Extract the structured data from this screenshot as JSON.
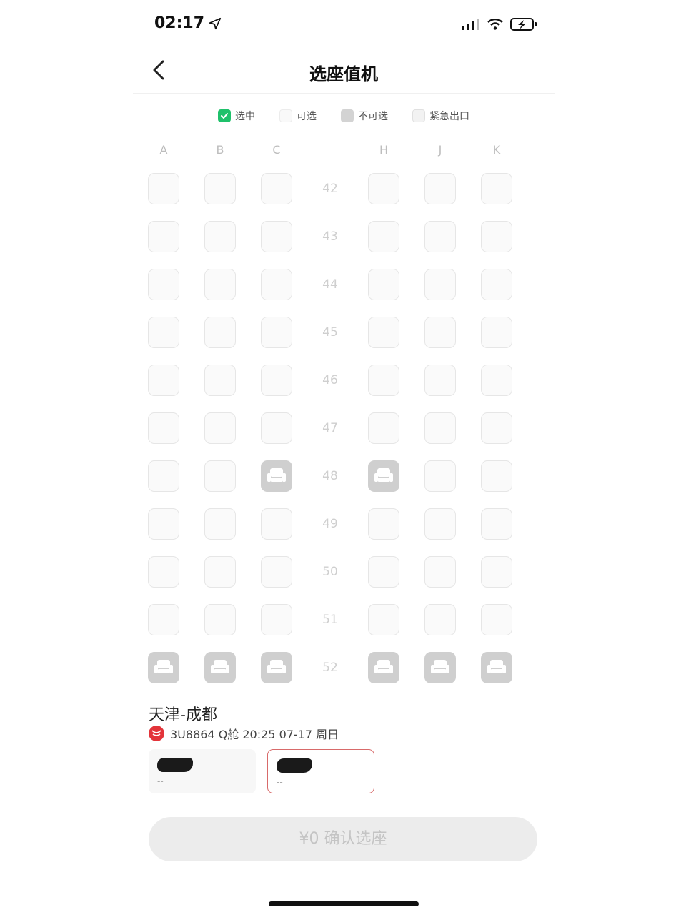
{
  "status": {
    "time": "02:17"
  },
  "header": {
    "title": "选座值机"
  },
  "legend": [
    {
      "label": "选中",
      "icon": "check-icon"
    },
    {
      "label": "可选",
      "icon": "available-seat-icon"
    },
    {
      "label": "不可选",
      "icon": "unavailable-seat-icon"
    },
    {
      "label": "紧急出口",
      "icon": "emergency-exit-icon"
    }
  ],
  "columns": [
    "A",
    "B",
    "C",
    "H",
    "J",
    "K"
  ],
  "rows": [
    {
      "number": "42",
      "unavailable": []
    },
    {
      "number": "43",
      "unavailable": []
    },
    {
      "number": "44",
      "unavailable": []
    },
    {
      "number": "45",
      "unavailable": []
    },
    {
      "number": "46",
      "unavailable": []
    },
    {
      "number": "47",
      "unavailable": []
    },
    {
      "number": "48",
      "unavailable": [
        "C",
        "H"
      ]
    },
    {
      "number": "49",
      "unavailable": []
    },
    {
      "number": "50",
      "unavailable": []
    },
    {
      "number": "51",
      "unavailable": []
    },
    {
      "number": "52",
      "unavailable": [
        "A",
        "B",
        "C",
        "H",
        "J",
        "K"
      ]
    }
  ],
  "flight": {
    "route": "天津-成都",
    "info": "3U8864 Q舱 20:25 07-17 周日"
  },
  "passengers": [
    {
      "seat": "--",
      "active": false
    },
    {
      "seat": "--",
      "active": true
    }
  ],
  "footer": {
    "confirm_label": "¥0 确认选座"
  },
  "colors": {
    "selected": "#1fc16b",
    "unavailable": "#cfcfcf",
    "active_border": "#d86a6a"
  }
}
